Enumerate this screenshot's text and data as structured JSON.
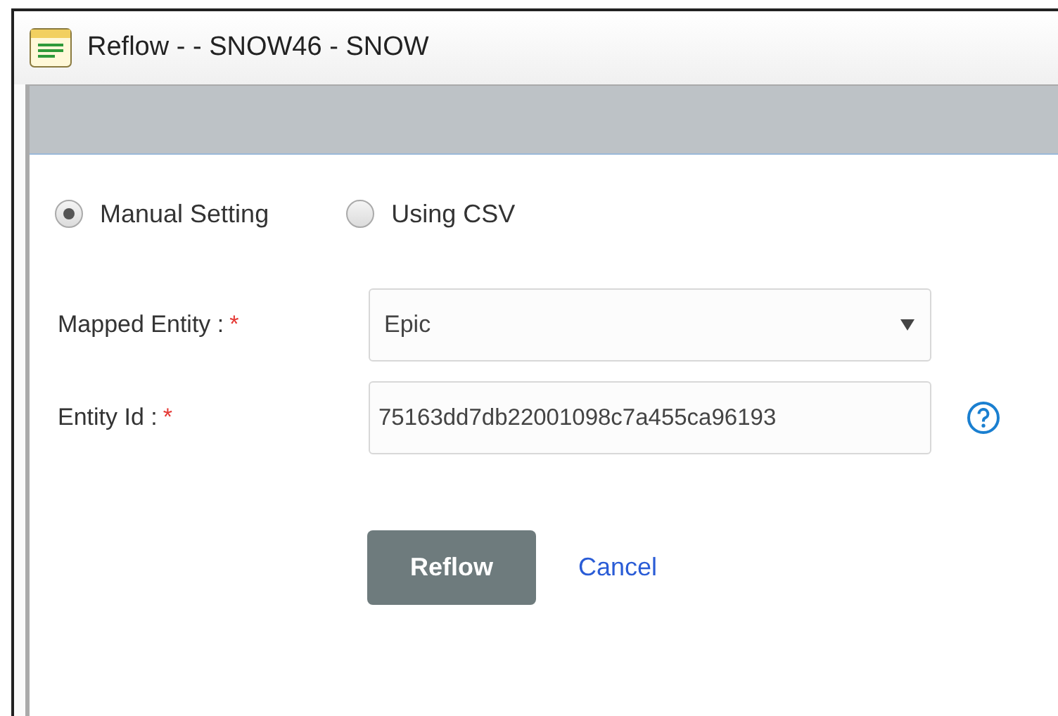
{
  "window": {
    "title": "Reflow - - SNOW46 - SNOW"
  },
  "mode_options": [
    {
      "label": "Manual Setting",
      "selected": true
    },
    {
      "label": "Using CSV",
      "selected": false
    }
  ],
  "fields": [
    {
      "kind": "dropdown",
      "label": "Mapped Entity :",
      "required_mark": "*",
      "value": "Epic",
      "help": false
    },
    {
      "kind": "text",
      "label": "Entity Id :",
      "required_mark": "*",
      "value": "75163dd7db22001098c7a455ca96193",
      "help": true
    }
  ],
  "buttons": {
    "primary": "Reflow",
    "secondary": "Cancel"
  }
}
